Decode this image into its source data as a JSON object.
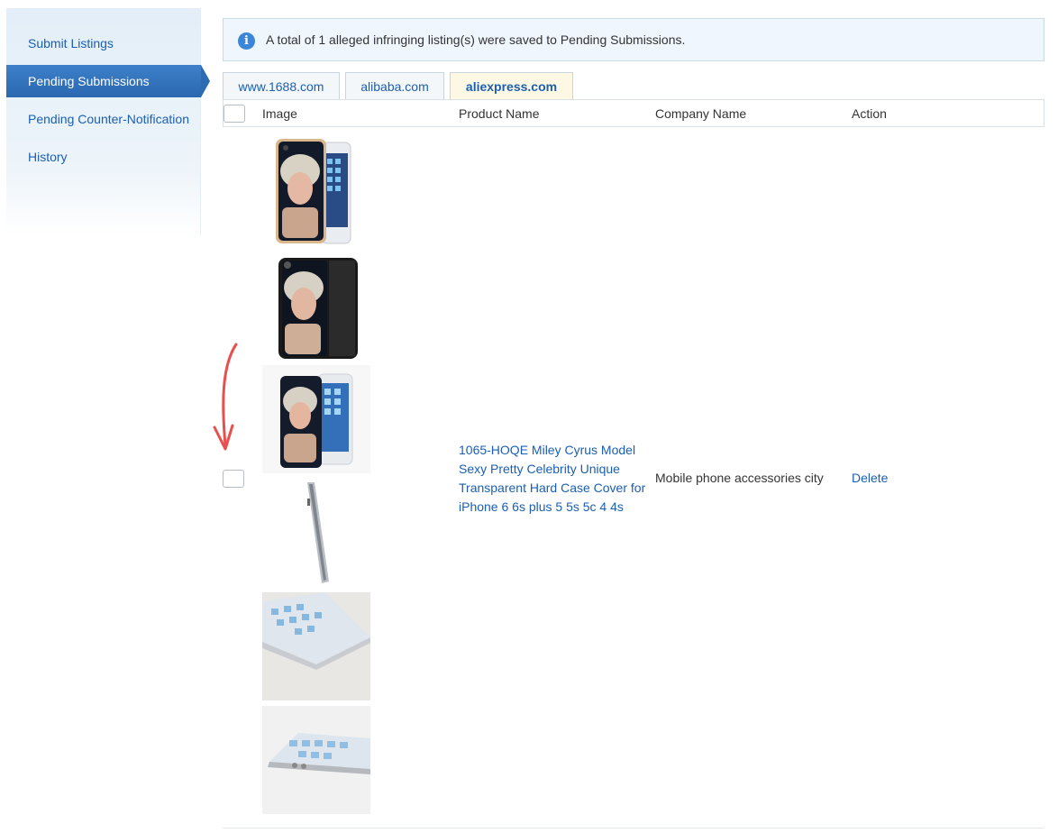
{
  "sidebar": {
    "items": [
      {
        "label": "Submit Listings"
      },
      {
        "label": "Pending Submissions"
      },
      {
        "label": "Pending Counter-Notification"
      },
      {
        "label": "History"
      }
    ]
  },
  "notice": {
    "text": "A total of 1 alleged infringing listing(s) were saved to Pending Submissions."
  },
  "tabs": [
    {
      "label": "www.1688.com"
    },
    {
      "label": "alibaba.com"
    },
    {
      "label": "aliexpress.com"
    }
  ],
  "table": {
    "headers": {
      "image": "Image",
      "product_name": "Product Name",
      "company_name": "Company Name",
      "action": "Action"
    },
    "rows": [
      {
        "product_name": "1065-HOQE Miley Cyrus Model Sexy Pretty Celebrity Unique Transparent Hard Case Cover for iPhone 6 6s plus 5 5s 5c 4 4s",
        "company_name": "Mobile phone accessories city",
        "action": "Delete"
      }
    ]
  },
  "colors": {
    "link": "#1a5fb4",
    "sidebar_active": "#2d6bb3",
    "active_tab_bg": "#fdf8e3",
    "annotation_arrow": "#e8504f"
  }
}
